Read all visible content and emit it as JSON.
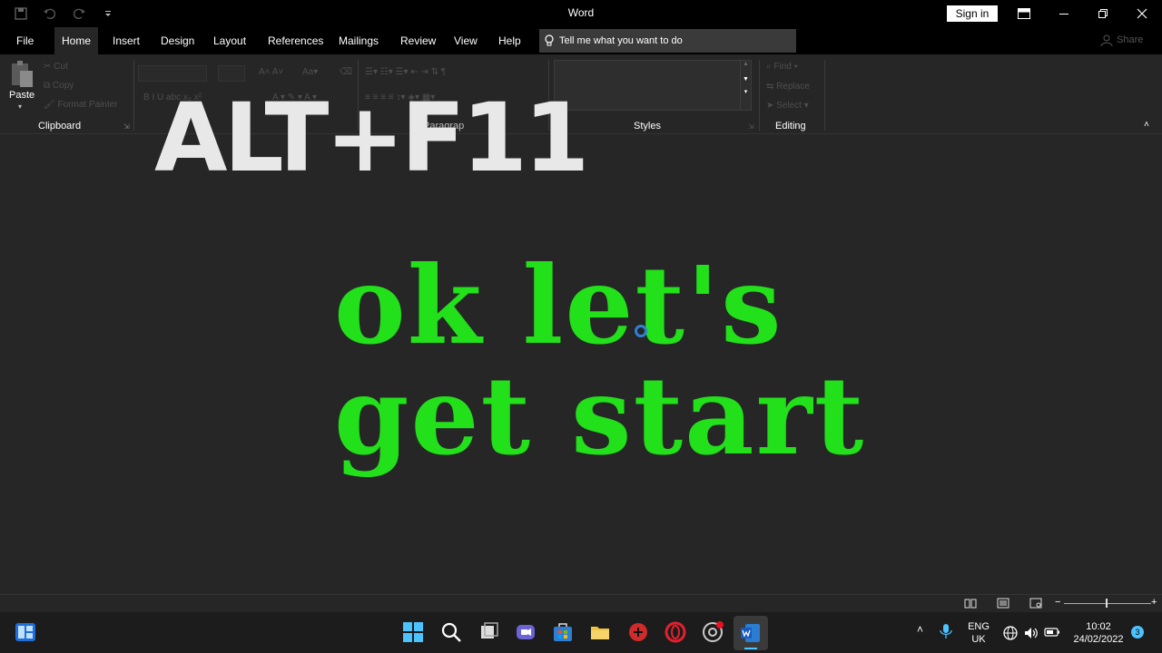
{
  "window": {
    "title": "Word",
    "sign_in": "Sign in",
    "share": "Share"
  },
  "tabs": [
    "File",
    "Home",
    "Insert",
    "Design",
    "Layout",
    "References",
    "Mailings",
    "Review",
    "View",
    "Help"
  ],
  "tell_me": "Tell me what you want to do",
  "ribbon": {
    "clipboard": {
      "paste": "Paste",
      "cut": "Cut",
      "copy": "Copy",
      "format_painter": "Format Painter",
      "label": "Clipboard"
    },
    "font_label_partial": "t",
    "paragraph_label_partial": "Paragrap",
    "styles_label": "Styles",
    "editing": {
      "find": "Find",
      "replace": "Replace",
      "select": "Select",
      "label": "Editing"
    }
  },
  "overlay_text": "ALT+F11",
  "document": {
    "line1": "ok let's",
    "line2": "get start"
  },
  "taskbar": {
    "lang_top": "ENG",
    "lang_bottom": "UK",
    "time": "10:02",
    "date": "24/02/2022",
    "notifications": "3"
  },
  "colors": {
    "doc_text": "#22e01a",
    "background": "#262626",
    "titlebar": "#000000"
  }
}
